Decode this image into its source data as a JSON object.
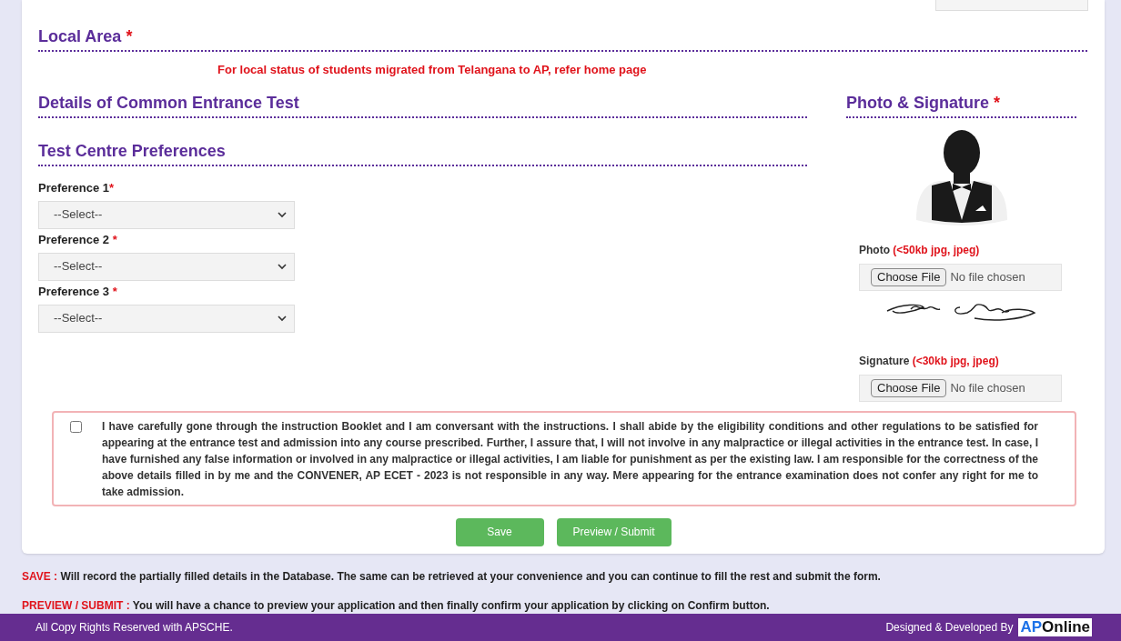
{
  "local_area": {
    "heading": "Local Area",
    "required": "*",
    "note": "For local status of students migrated from Telangana to AP, refer home page"
  },
  "cet_details": {
    "heading": "Details of Common Entrance Test"
  },
  "test_centre": {
    "heading": "Test Centre Preferences",
    "preferences": [
      {
        "label": "Preference 1",
        "required": "*",
        "value": "--Select--"
      },
      {
        "label": "Preference 2",
        "required": " *",
        "value": "--Select--"
      },
      {
        "label": "Preference 3",
        "required": " *",
        "value": "--Select--"
      }
    ]
  },
  "photo_signature": {
    "heading": "Photo & Signature",
    "required": "*",
    "uploads": [
      {
        "kind": "photo",
        "label": "Photo",
        "hint": "(<50kb jpg, jpeg)",
        "button": "Choose File",
        "status": "No file chosen"
      },
      {
        "kind": "signature",
        "label": "Signature",
        "hint": "(<30kb jpg, jpeg)",
        "button": "Choose File",
        "status": "No file chosen"
      }
    ]
  },
  "declaration": {
    "checked": false,
    "text": "I have carefully gone through the instruction Booklet and I am conversant with the instructions. I shall abide by the eligibility conditions and other regulations to be satisfied for appearing at the entrance test and admission into any course prescribed. Further, I assure that, I will not involve in any malpractice or illegal activities in the entrance test. In case, I have furnished any false information or involved in any malpractice or illegal activities, I am liable for punishment as per the existing law. I am responsible for the correctness of the above details filled in by me and the CONVENER, AP ECET - 2023 is not responsible in any way. Mere appearing for the entrance examination does not confer any right for me to take admission."
  },
  "buttons": [
    "Save",
    "Preview / Submit"
  ],
  "notes": [
    {
      "term": "SAVE :",
      "text": "Will record the partially filled details in the Database. The same can be retrieved at your convenience and you can continue to fill the rest and submit the form."
    },
    {
      "term": "PREVIEW / SUBMIT :",
      "text": "You will have a chance to preview your application and then finally confirm your application by clicking on Confirm button."
    }
  ],
  "footer": {
    "copyright": "All Copy Rights Reserved with APSCHE.",
    "credit": "Designed & Developed By",
    "logo_prefix": "AP",
    "logo_suffix": "Online"
  }
}
